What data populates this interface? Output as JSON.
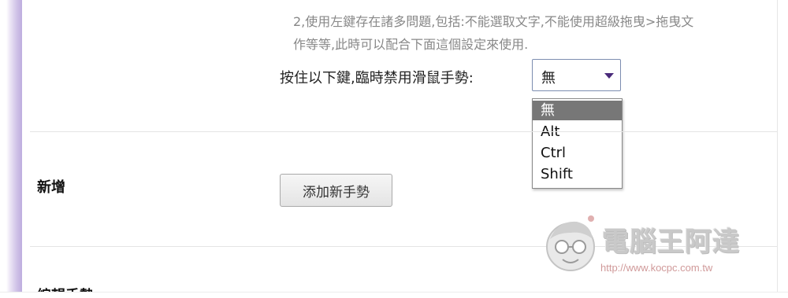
{
  "description": {
    "line1": "2,使用左鍵存在諸多問題,包括:不能選取文字,不能使用超級拖曳>拖曳文",
    "line2": "作等等,此時可以配合下面這個設定來使用."
  },
  "disable_gesture": {
    "label": "按住以下鍵,臨時禁用滑鼠手勢:",
    "selected": "無",
    "options": [
      "無",
      "Alt",
      "Ctrl",
      "Shift"
    ]
  },
  "add_section": {
    "title": "新增",
    "button_label": "添加新手勢"
  },
  "edit_section": {
    "title": "編輯手勢"
  },
  "watermark": {
    "name": "電腦王阿達",
    "url": "http://www.kocpc.com.tw"
  }
}
